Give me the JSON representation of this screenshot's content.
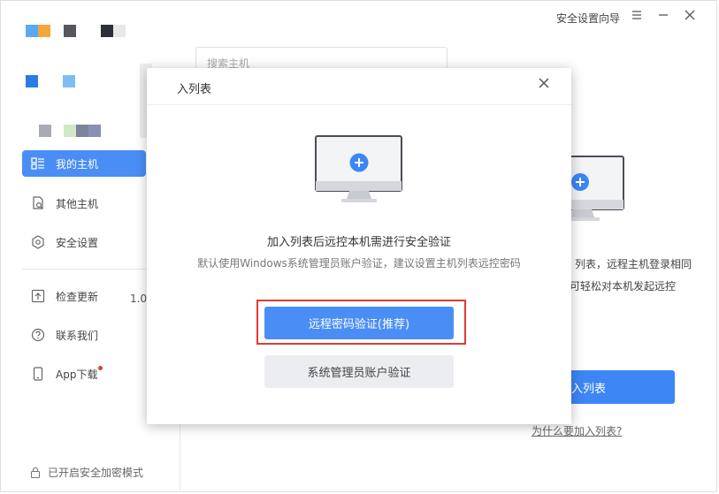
{
  "window": {
    "setup_wizard": "安全设置向导",
    "menu_icon": "menu-icon",
    "minimize_icon": "minimize-icon",
    "close_icon": "close-icon"
  },
  "sidebar": {
    "items": [
      {
        "label": "我的主机",
        "icon": "host-list-icon",
        "active": true
      },
      {
        "label": "其他主机",
        "icon": "document-search-icon"
      },
      {
        "label": "安全设置",
        "icon": "hexagon-settings-icon"
      },
      {
        "label": "检查更新",
        "icon": "upload-icon"
      },
      {
        "label": "联系我们",
        "icon": "question-icon"
      },
      {
        "label": "App下载",
        "icon": "phone-icon"
      }
    ],
    "version": "1.0.",
    "encrypt_mode": "已开启安全加密模式"
  },
  "main": {
    "search_placeholder": "搜索主机",
    "bg_line1": "列表，远程主机登录相同",
    "bg_line2": "可轻松对本机发起远控",
    "add_button": "入列表",
    "why_link": "为什么要加入列表?"
  },
  "modal": {
    "title": "入列表",
    "heading": "加入列表后远控本机需进行安全验证",
    "subtext": "默认使用Windows系统管理员账户验证，建议设置主机列表远控密码",
    "primary_button": "远程密码验证(推荐)",
    "secondary_button": "系统管理员账户验证"
  },
  "colors": {
    "accent": "#4a8ef5",
    "highlight": "#e53935"
  }
}
